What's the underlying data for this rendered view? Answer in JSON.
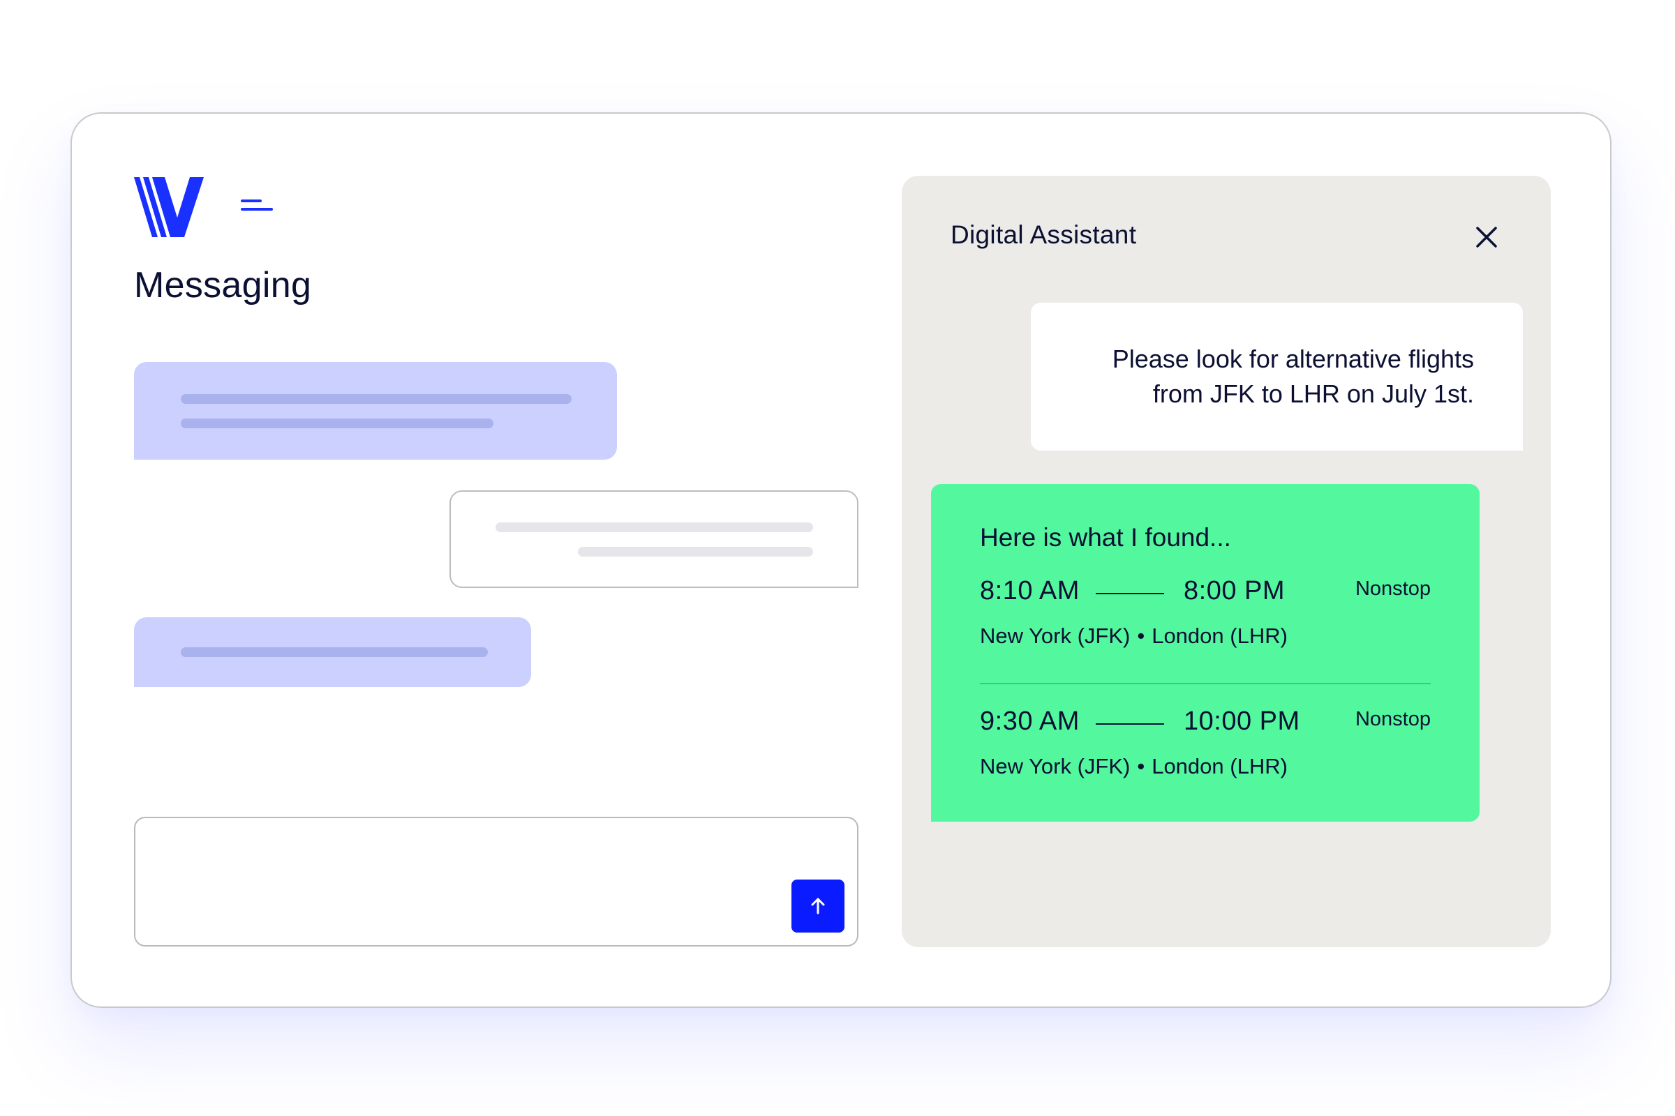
{
  "app": {
    "title": "Messaging",
    "brand_color": "#1930ff",
    "logo_icon": "v-logo-icon",
    "menu_icon": "menu-icon"
  },
  "composer": {
    "value": "",
    "send_icon": "arrow-up-icon",
    "send_color": "#0a1cff"
  },
  "assistant": {
    "title": "Digital Assistant",
    "close_icon": "close-icon",
    "user_message": {
      "line1": "Please look for alternative flights",
      "line2": "from JFK to LHR on July 1st."
    },
    "bot_message": {
      "intro": "Here is what I found...",
      "bubble_color": "#52f79e",
      "flights": [
        {
          "departure": "8:10 AM",
          "arrival": "8:00 PM",
          "stops": "Nonstop",
          "origin": "New York (JFK)",
          "separator": "•",
          "destination": "London (LHR)"
        },
        {
          "departure": "9:30 AM",
          "arrival": "10:00 PM",
          "stops": "Nonstop",
          "origin": "New York (JFK)",
          "separator": "•",
          "destination": "London (LHR)"
        }
      ]
    }
  }
}
